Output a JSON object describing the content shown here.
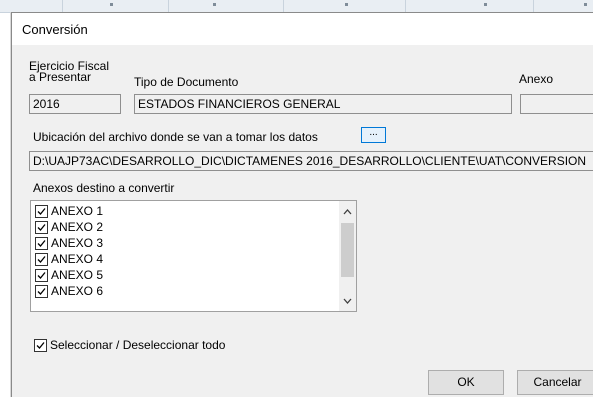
{
  "dialog": {
    "title": "Conversión"
  },
  "fiscal_year": {
    "label_line1": "Ejercicio Fiscal",
    "label_line2": "a Presentar",
    "value": "2016"
  },
  "document_type": {
    "label": "Tipo de Documento",
    "value": "ESTADOS FINANCIEROS GENERAL"
  },
  "annex": {
    "label": "Anexo",
    "value": ""
  },
  "file_location": {
    "label": "Ubicación del archivo donde se van a tomar los datos",
    "browse_label": "...",
    "path": "D:\\UAJP73AC\\DESARROLLO_DIC\\DICTAMENES 2016_DESARROLLO\\CLIENTE\\UAT\\CONVERSION"
  },
  "annex_list": {
    "label": "Anexos destino a convertir",
    "items": [
      {
        "label": "ANEXO 1",
        "checked": true
      },
      {
        "label": "ANEXO 2",
        "checked": true
      },
      {
        "label": "ANEXO 3",
        "checked": true
      },
      {
        "label": "ANEXO 4",
        "checked": true
      },
      {
        "label": "ANEXO 5",
        "checked": true
      },
      {
        "label": "ANEXO 6",
        "checked": true
      }
    ],
    "scroll_up_icon": "scroll-up-arrow",
    "scroll_down_icon": "scroll-down-arrow"
  },
  "select_all": {
    "label": "Seleccionar / Deseleccionar todo",
    "checked": true
  },
  "buttons": {
    "ok": "OK",
    "cancel": "Cancelar"
  },
  "colors": {
    "dialog_bg": "#f0f0f0",
    "focus_accent": "#0078d7"
  }
}
